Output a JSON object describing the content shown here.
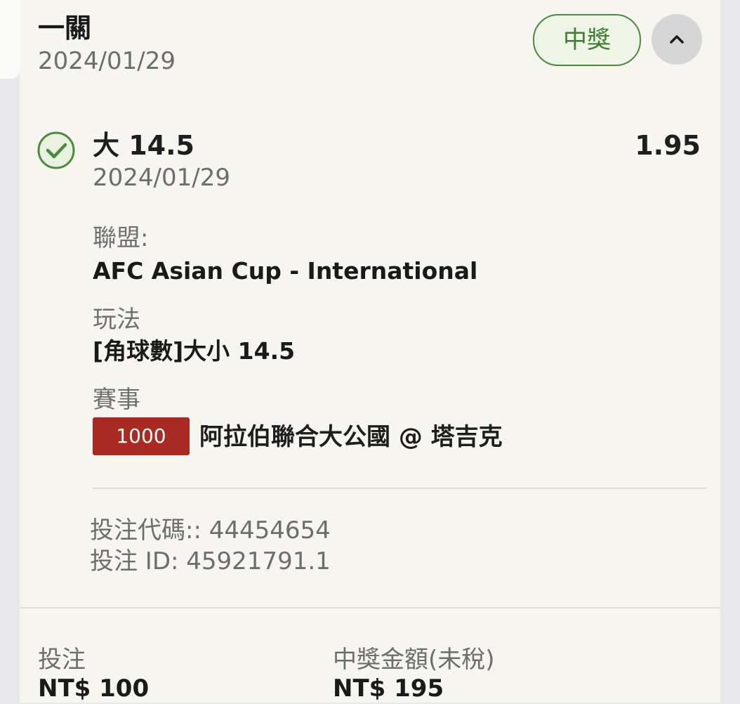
{
  "header": {
    "title": "一關",
    "date": "2024/01/29",
    "status_badge": "中獎"
  },
  "selection": {
    "title": "大 14.5",
    "odds": "1.95",
    "date": "2024/01/29",
    "league_label": "聯盟:",
    "league_value": "AFC Asian Cup - International",
    "market_label": "玩法",
    "market_value": "[角球數]大小 14.5",
    "event_label": "賽事",
    "event_code": "1000",
    "event_name": "阿拉伯聯合大公國 @ 塔吉克"
  },
  "reference": {
    "bet_code": "投注代碼:: 44454654",
    "bet_id": "投注 ID: 45921791.1"
  },
  "footer": {
    "stake_label": "投注",
    "stake_value": "NT$ 100",
    "payout_label": "中獎金額(未稅)",
    "payout_value": "NT$ 195"
  },
  "colors": {
    "card_background": "#f6f5ef",
    "win_green": "#4b8c3c",
    "event_code_red": "#a82a22",
    "muted_text": "#6d6d6d"
  },
  "icons": {
    "status": "check-circle-icon",
    "collapse": "chevron-up-icon"
  }
}
